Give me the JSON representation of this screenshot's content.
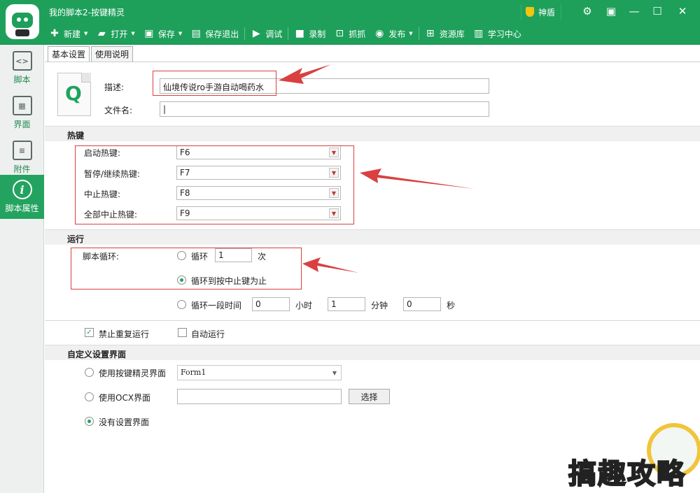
{
  "app": {
    "title": "我的脚本2-按键精灵",
    "shield_label": "神盾",
    "window_controls": [
      "gear",
      "menu",
      "minimize",
      "maximize",
      "close"
    ]
  },
  "toolbar": [
    {
      "label": "新建",
      "icon": "plus-icon",
      "dropdown": true
    },
    {
      "label": "打开",
      "icon": "folder-icon",
      "dropdown": true
    },
    {
      "label": "保存",
      "icon": "save-icon",
      "dropdown": true
    },
    {
      "label": "保存退出",
      "icon": "save-exit-icon",
      "dropdown": false
    },
    {
      "label": "调试",
      "icon": "play-icon",
      "dropdown": false
    },
    {
      "label": "录制",
      "icon": "camera-icon",
      "dropdown": false
    },
    {
      "label": "抓抓",
      "icon": "grab-icon",
      "dropdown": false
    },
    {
      "label": "发布",
      "icon": "publish-icon",
      "dropdown": true
    },
    {
      "label": "资源库",
      "icon": "library-icon",
      "dropdown": false
    },
    {
      "label": "学习中心",
      "icon": "book-icon",
      "dropdown": false
    }
  ],
  "sidebar": [
    {
      "label": "脚本",
      "icon": "code-icon",
      "active": false
    },
    {
      "label": "界面",
      "icon": "grid-icon",
      "active": false
    },
    {
      "label": "附件",
      "icon": "attachment-icon",
      "active": false
    },
    {
      "label": "脚本属性",
      "icon": "info-icon",
      "active": true
    }
  ],
  "tabs": [
    {
      "label": "基本设置",
      "active": true
    },
    {
      "label": "使用说明",
      "active": false
    }
  ],
  "basic": {
    "desc_label": "描述:",
    "desc_value": "仙境传说ro手游自动喝药水",
    "filename_label": "文件名:",
    "filename_value": "|"
  },
  "hotkeys": {
    "section_title": "热键",
    "items": [
      {
        "label": "启动热键:",
        "value": "F6"
      },
      {
        "label": "暂停/继续热键:",
        "value": "F7"
      },
      {
        "label": "中止热键:",
        "value": "F8"
      },
      {
        "label": "全部中止热键:",
        "value": "F9"
      }
    ]
  },
  "run": {
    "section_title": "运行",
    "loop_label": "脚本循环:",
    "loop_count_label": "循环",
    "loop_count_value": "1",
    "loop_count_unit": "次",
    "loop_until_label": "循环到按中止键为止",
    "loop_period_label": "循环一段时间",
    "hours_value": "0",
    "hours_unit": "小时",
    "minutes_value": "1",
    "minutes_unit": "分钟",
    "seconds_value": "0",
    "seconds_unit": "秒",
    "selected": "until_stop"
  },
  "options": {
    "no_repeat_label": "禁止重复运行",
    "no_repeat_checked": true,
    "auto_run_label": "自动运行",
    "auto_run_checked": false
  },
  "custom_ui": {
    "section_title": "自定义设置界面",
    "use_form_label": "使用按键精灵界面",
    "form_value": "Form1",
    "use_ocx_label": "使用OCX界面",
    "ocx_value": "",
    "select_button": "选择",
    "none_label": "没有设置界面",
    "selected": "none"
  },
  "watermark": {
    "text": "搞趣攻略"
  },
  "colors": {
    "brand": "#1ea05a",
    "highlight": "#d94040"
  }
}
